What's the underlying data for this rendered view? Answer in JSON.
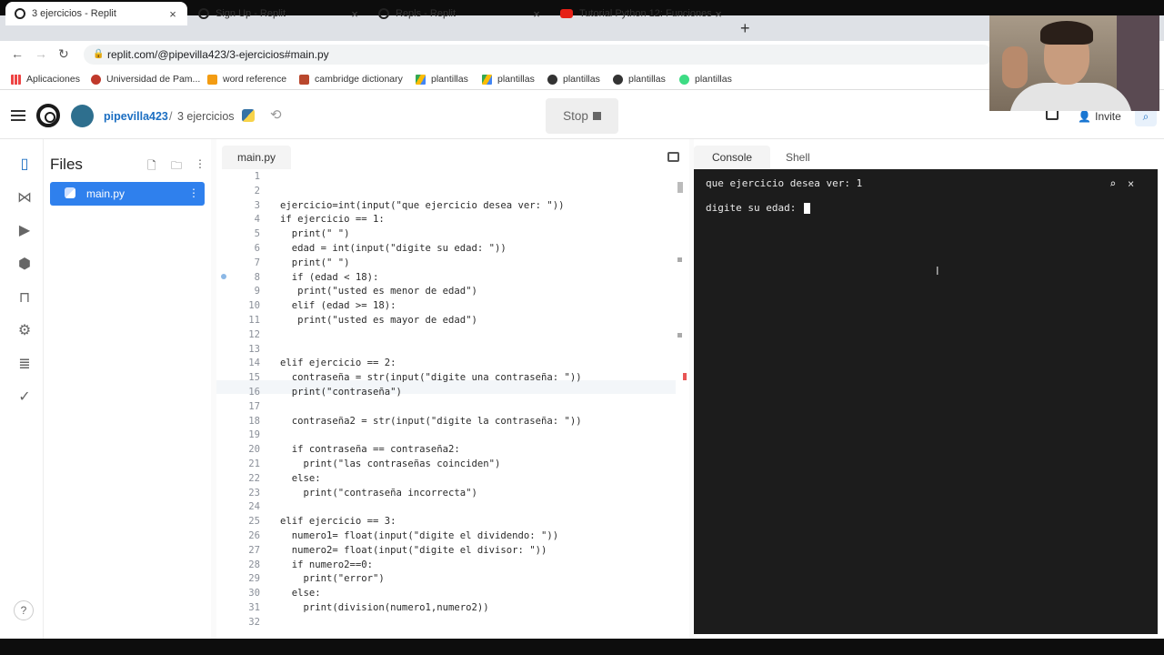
{
  "browser": {
    "tabs": [
      {
        "title": "3 ejercicios - Replit",
        "active": true
      },
      {
        "title": "Sign Up - Replit",
        "active": false
      },
      {
        "title": "Repls - Replit",
        "active": false
      },
      {
        "title": "Tutorial Python 12: Funciones - Y",
        "active": false
      }
    ],
    "new_tab": "+",
    "url": "replit.com/@pipevilla423/3-ejercicios#main.py",
    "bookmarks": [
      "Aplicaciones",
      "Universidad de Pam...",
      "word reference",
      "cambridge dictionary",
      "plantillas",
      "plantillas",
      "plantillas",
      "plantillas",
      "plantillas"
    ]
  },
  "header": {
    "username": "pipevilla423",
    "separator": "/",
    "project": "3 ejercicios",
    "stop_label": "Stop",
    "invite_label": "Invite"
  },
  "files": {
    "title": "Files",
    "items": [
      {
        "name": "main.py"
      }
    ]
  },
  "editor": {
    "tab": "main.py",
    "lines": [
      "",
      "",
      "ejercicio=int(input(\"que ejercicio desea ver: \"))",
      "if ejercicio == 1:",
      "  print(\" \")",
      "  edad = int(input(\"digite su edad: \"))",
      "  print(\" \")",
      "  if (edad < 18):",
      "   print(\"usted es menor de edad\")",
      "  elif (edad >= 18):",
      "   print(\"usted es mayor de edad\")",
      "",
      "",
      "elif ejercicio == 2:",
      "  contraseña = str(input(\"digite una contraseña: \"))",
      "  print(\"contraseña\")",
      "",
      "  contraseña2 = str(input(\"digite la contraseña: \"))",
      "",
      "  if contraseña == contraseña2:",
      "    print(\"las contraseñas coinciden\")",
      "  else:",
      "    print(\"contraseña incorrecta\")",
      "",
      "elif ejercicio == 3:",
      "  numero1= float(input(\"digite el dividendo: \"))",
      "  numero2= float(input(\"digite el divisor: \"))",
      "  if numero2==0:",
      "    print(\"error\")",
      "  else:",
      "    print(division(numero1,numero2))",
      ""
    ]
  },
  "console": {
    "tabs": [
      "Console",
      "Shell"
    ],
    "lines": [
      "que ejercicio desea ver: 1",
      "digite su edad: "
    ]
  },
  "colors": {
    "accent": "#2f80ed",
    "link": "#1b6ec2",
    "console_bg": "#1c1c1c"
  }
}
